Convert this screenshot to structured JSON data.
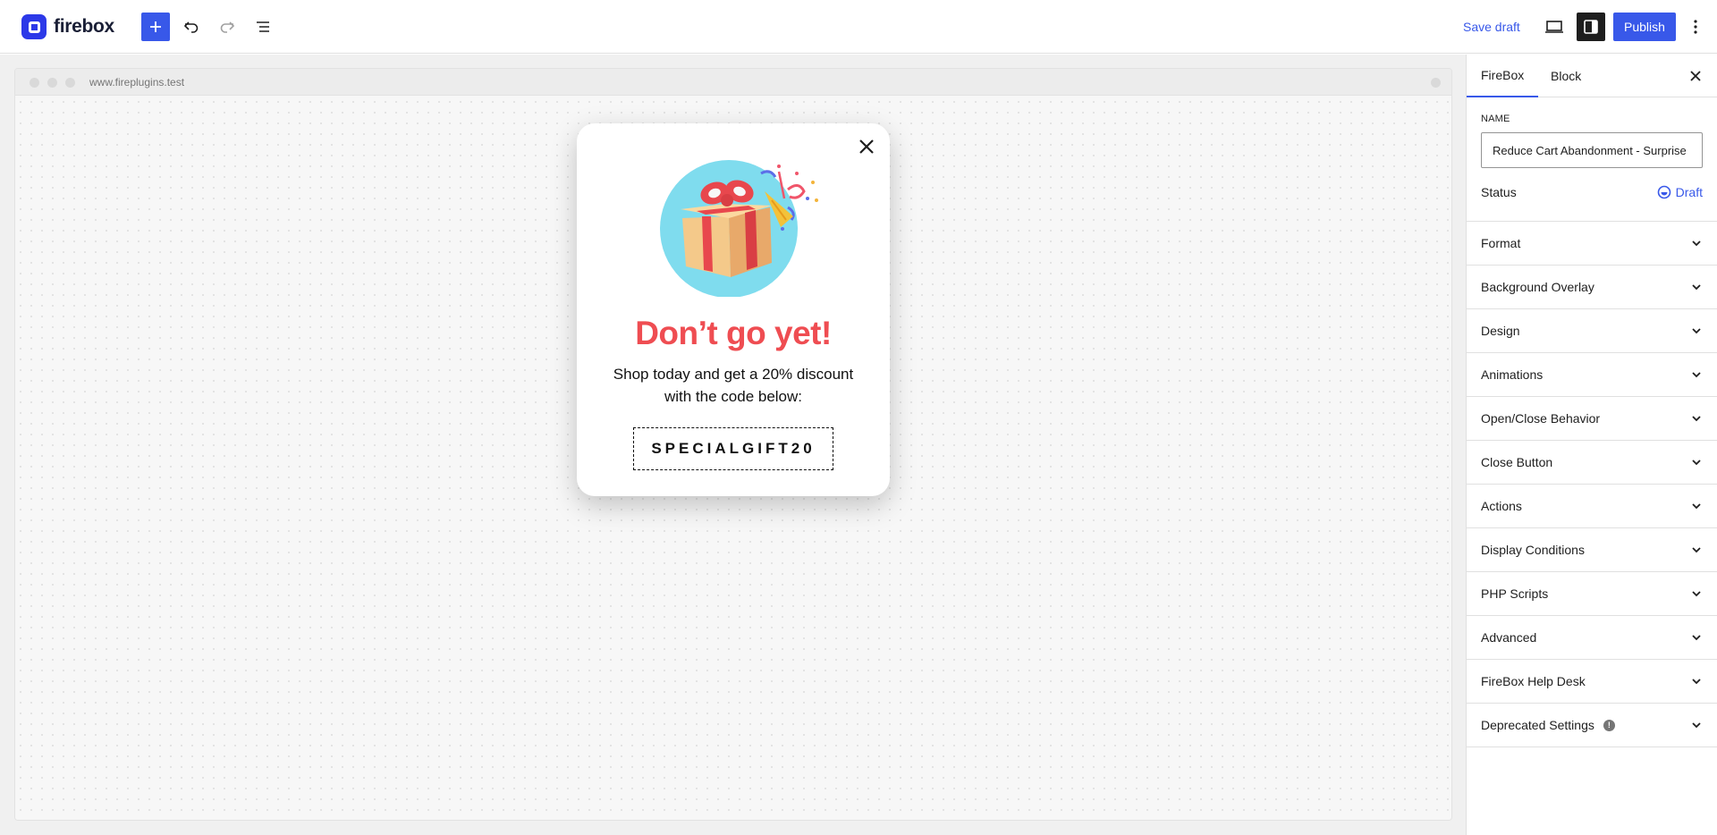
{
  "header": {
    "logo_text": "firebox",
    "save_draft_label": "Save draft",
    "publish_label": "Publish",
    "icons": [
      "plus-icon",
      "undo-icon",
      "redo-icon",
      "list-view-icon",
      "desktop-view-icon",
      "settings-sidebar-icon",
      "more-vertical-icon"
    ]
  },
  "browser": {
    "url": "www.fireplugins.test"
  },
  "popup": {
    "heading": "Don’t go yet!",
    "body": "Shop today and get a 20% discount with the code below:",
    "coupon_code": "SPECIALGIFT20",
    "heading_color": "#ef4d52"
  },
  "sidebar": {
    "tabs": [
      {
        "label": "FireBox",
        "active": true
      },
      {
        "label": "Block",
        "active": false
      }
    ],
    "name_label": "NAME",
    "name_value": "Reduce Cart Abandonment - Surprise",
    "status_label": "Status",
    "status_value": "Draft",
    "panels": [
      {
        "label": "Format"
      },
      {
        "label": "Background Overlay"
      },
      {
        "label": "Design"
      },
      {
        "label": "Animations"
      },
      {
        "label": "Open/Close Behavior"
      },
      {
        "label": "Close Button"
      },
      {
        "label": "Actions"
      },
      {
        "label": "Display Conditions"
      },
      {
        "label": "PHP Scripts"
      },
      {
        "label": "Advanced"
      },
      {
        "label": "FireBox Help Desk"
      },
      {
        "label": "Deprecated Settings",
        "info_icon": true
      }
    ]
  },
  "colors": {
    "accent": "#3858e9",
    "brand": "#2c39e8"
  }
}
